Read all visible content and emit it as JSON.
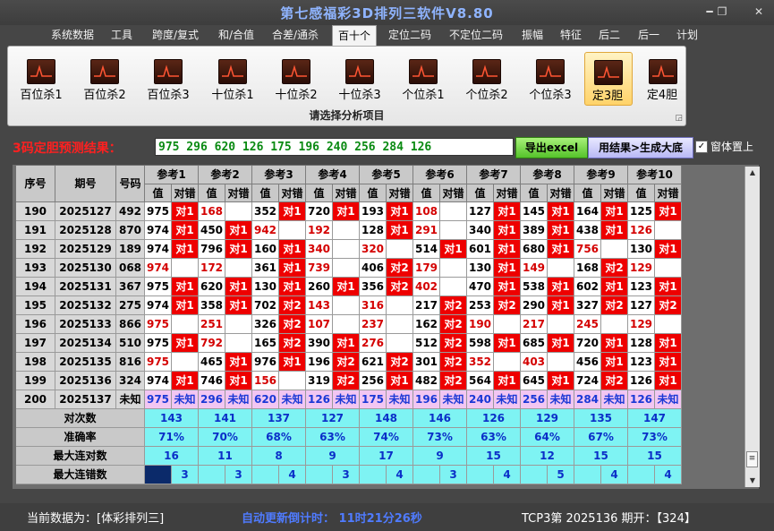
{
  "window": {
    "title": "第七感福彩3D排列三软件V8.80"
  },
  "menu": [
    "系统数据",
    "工具",
    "跨度/复式",
    "和/合值",
    "合差/通杀",
    "百十个",
    "定位二码",
    "不定位二码",
    "振幅",
    "特征",
    "后二",
    "后一",
    "计划"
  ],
  "menu_active": "百十个",
  "ribbon": {
    "buttons": [
      "百位杀1",
      "百位杀2",
      "百位杀3",
      "十位杀1",
      "十位杀2",
      "十位杀3",
      "个位杀1",
      "个位杀2",
      "个位杀3",
      "定3胆",
      "定4胆"
    ],
    "selected": "定3胆",
    "caption": "请选择分析项目"
  },
  "prediction": {
    "label": "3码定胆预测结果：",
    "value": "975  296  620  126  175  196  240  256  284  126",
    "excel_button": "导出excel",
    "generate_button": "用结果>生成大底",
    "pin_checkbox": "窗体置上",
    "pin_checked": true,
    "check_mark": "✓"
  },
  "table": {
    "col_seq": "序号",
    "col_period": "期号",
    "col_number": "号码",
    "ref_headers": [
      "参考1",
      "参考2",
      "参考3",
      "参考4",
      "参考5",
      "参考6",
      "参考7",
      "参考8",
      "参考9",
      "参考10"
    ],
    "sub_value": "值",
    "sub_result": "对错",
    "rows": [
      {
        "seq": "190",
        "period": "2025127",
        "num": "492",
        "refs": [
          [
            "975",
            "对1"
          ],
          [
            "168",
            ""
          ],
          [
            "352",
            "对1"
          ],
          [
            "720",
            "对1"
          ],
          [
            "193",
            "对1"
          ],
          [
            "108",
            ""
          ],
          [
            "127",
            "对1"
          ],
          [
            "145",
            "对1"
          ],
          [
            "164",
            "对1"
          ],
          [
            "125",
            "对1"
          ]
        ]
      },
      {
        "seq": "191",
        "period": "2025128",
        "num": "870",
        "refs": [
          [
            "974",
            "对1"
          ],
          [
            "450",
            "对1"
          ],
          [
            "942",
            ""
          ],
          [
            "192",
            ""
          ],
          [
            "128",
            "对1"
          ],
          [
            "291",
            ""
          ],
          [
            "340",
            "对1"
          ],
          [
            "389",
            "对1"
          ],
          [
            "438",
            "对1"
          ],
          [
            "126",
            ""
          ]
        ]
      },
      {
        "seq": "192",
        "period": "2025129",
        "num": "189",
        "refs": [
          [
            "974",
            "对1"
          ],
          [
            "796",
            "对1"
          ],
          [
            "160",
            "对1"
          ],
          [
            "340",
            ""
          ],
          [
            "320",
            ""
          ],
          [
            "514",
            "对1"
          ],
          [
            "601",
            "对1"
          ],
          [
            "680",
            "对1"
          ],
          [
            "756",
            ""
          ],
          [
            "130",
            "对1"
          ]
        ]
      },
      {
        "seq": "193",
        "period": "2025130",
        "num": "068",
        "refs": [
          [
            "974",
            ""
          ],
          [
            "172",
            ""
          ],
          [
            "361",
            "对1"
          ],
          [
            "739",
            ""
          ],
          [
            "406",
            "对2"
          ],
          [
            "179",
            ""
          ],
          [
            "130",
            "对1"
          ],
          [
            "149",
            ""
          ],
          [
            "168",
            "对2"
          ],
          [
            "129",
            ""
          ]
        ]
      },
      {
        "seq": "194",
        "period": "2025131",
        "num": "367",
        "refs": [
          [
            "975",
            "对1"
          ],
          [
            "620",
            "对1"
          ],
          [
            "130",
            "对1"
          ],
          [
            "260",
            "对1"
          ],
          [
            "356",
            "对2"
          ],
          [
            "402",
            ""
          ],
          [
            "470",
            "对1"
          ],
          [
            "538",
            "对1"
          ],
          [
            "602",
            "对1"
          ],
          [
            "123",
            "对1"
          ]
        ]
      },
      {
        "seq": "195",
        "period": "2025132",
        "num": "275",
        "refs": [
          [
            "974",
            "对1"
          ],
          [
            "358",
            "对1"
          ],
          [
            "702",
            "对2"
          ],
          [
            "143",
            ""
          ],
          [
            "316",
            ""
          ],
          [
            "217",
            "对2"
          ],
          [
            "253",
            "对2"
          ],
          [
            "290",
            "对1"
          ],
          [
            "327",
            "对2"
          ],
          [
            "127",
            "对2"
          ]
        ]
      },
      {
        "seq": "196",
        "period": "2025133",
        "num": "866",
        "refs": [
          [
            "975",
            ""
          ],
          [
            "251",
            ""
          ],
          [
            "326",
            "对2"
          ],
          [
            "107",
            ""
          ],
          [
            "237",
            ""
          ],
          [
            "162",
            "对2"
          ],
          [
            "190",
            ""
          ],
          [
            "217",
            ""
          ],
          [
            "245",
            ""
          ],
          [
            "129",
            ""
          ]
        ]
      },
      {
        "seq": "197",
        "period": "2025134",
        "num": "510",
        "refs": [
          [
            "975",
            "对1"
          ],
          [
            "792",
            ""
          ],
          [
            "165",
            "对2"
          ],
          [
            "390",
            "对1"
          ],
          [
            "276",
            ""
          ],
          [
            "512",
            "对2"
          ],
          [
            "598",
            "对1"
          ],
          [
            "685",
            "对1"
          ],
          [
            "720",
            "对1"
          ],
          [
            "128",
            "对1"
          ]
        ]
      },
      {
        "seq": "198",
        "period": "2025135",
        "num": "816",
        "refs": [
          [
            "975",
            ""
          ],
          [
            "465",
            "对1"
          ],
          [
            "976",
            "对1"
          ],
          [
            "196",
            "对2"
          ],
          [
            "621",
            "对2"
          ],
          [
            "301",
            "对2"
          ],
          [
            "352",
            ""
          ],
          [
            "403",
            ""
          ],
          [
            "456",
            "对1"
          ],
          [
            "123",
            "对1"
          ]
        ]
      },
      {
        "seq": "199",
        "period": "2025136",
        "num": "324",
        "refs": [
          [
            "974",
            "对1"
          ],
          [
            "746",
            "对1"
          ],
          [
            "156",
            ""
          ],
          [
            "319",
            "对2"
          ],
          [
            "256",
            "对1"
          ],
          [
            "482",
            "对2"
          ],
          [
            "564",
            "对1"
          ],
          [
            "645",
            "对1"
          ],
          [
            "724",
            "对2"
          ],
          [
            "126",
            "对1"
          ]
        ]
      }
    ],
    "next_row": {
      "seq": "200",
      "period": "2025137",
      "num": "未知",
      "values": [
        "975",
        "296",
        "620",
        "126",
        "175",
        "196",
        "240",
        "256",
        "284",
        "126"
      ],
      "result": "未知"
    },
    "stats": [
      {
        "label": "对次数",
        "values": [
          "143",
          "141",
          "137",
          "127",
          "148",
          "146",
          "126",
          "129",
          "135",
          "147"
        ]
      },
      {
        "label": "准确率",
        "values": [
          "71%",
          "70%",
          "68%",
          "63%",
          "74%",
          "73%",
          "63%",
          "64%",
          "67%",
          "73%"
        ]
      },
      {
        "label": "最大连对数",
        "values": [
          "16",
          "11",
          "8",
          "9",
          "17",
          "9",
          "15",
          "12",
          "15",
          "15"
        ]
      },
      {
        "label": "最大连错数",
        "values": [
          "3",
          "3",
          "4",
          "3",
          "4",
          "3",
          "4",
          "5",
          "4",
          "4"
        ]
      }
    ]
  },
  "scroll": {
    "up_arrow": "▲",
    "down_arrow": "▼",
    "thumb_grip": "≡"
  },
  "window_buttons": {
    "minimize": "━",
    "restore": "❐",
    "close": "✕"
  },
  "status": {
    "left": "当前数据为：[体彩排列三]",
    "middle": "自动更新倒计时：  11时21分26秒",
    "right": "TCP3第 2025136 期开：【324】"
  },
  "colors": {
    "hit": "#ee0000",
    "stat_bg": "#7ef3f3",
    "stat_text": "#0b2fc8",
    "pred_text": "#0a8a12",
    "title": "#8fb4ff"
  }
}
